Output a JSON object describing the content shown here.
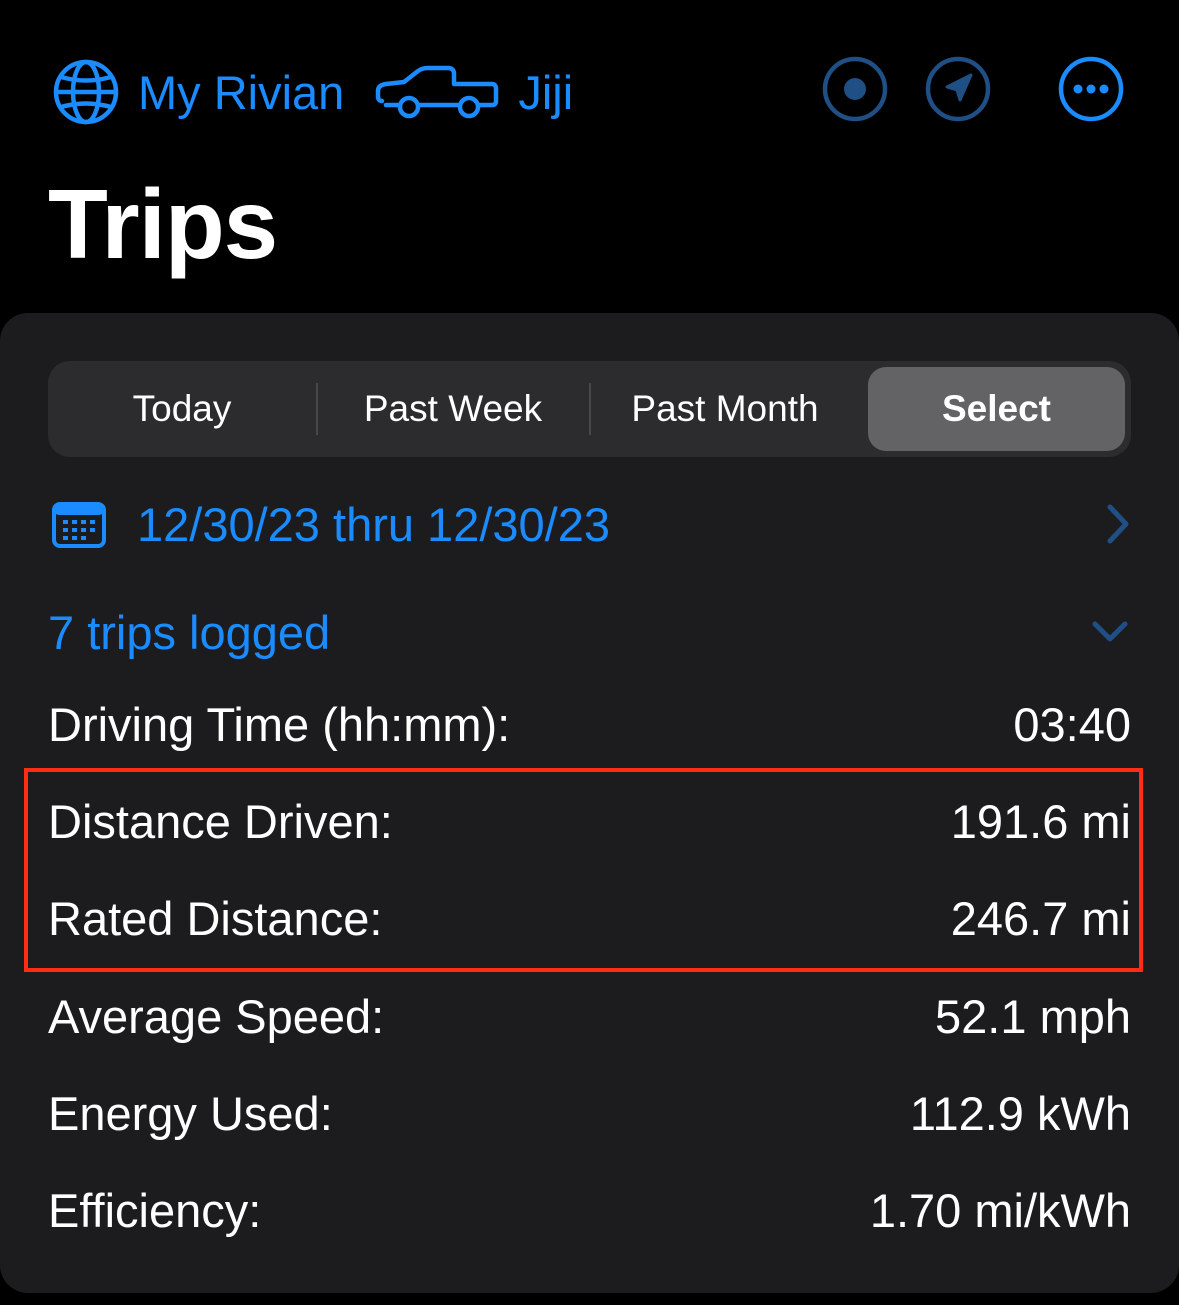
{
  "nav": {
    "home_label": "My Rivian",
    "vehicle_label": "Jiji",
    "icons": {
      "home": "globe-icon",
      "vehicle": "pickup-truck-icon",
      "record": "record-icon",
      "location": "location-arrow-icon",
      "more": "ellipsis-circle-icon"
    }
  },
  "page": {
    "title": "Trips"
  },
  "range_selector": {
    "options": [
      "Today",
      "Past Week",
      "Past Month",
      "Select"
    ],
    "selected": "Select"
  },
  "date_range": {
    "text": "12/30/23 thru 12/30/23",
    "icon": "calendar-icon"
  },
  "trips_logged": {
    "text": "7 trips logged"
  },
  "stats": [
    {
      "label": "Driving Time (hh:mm):",
      "value": "03:40"
    },
    {
      "label": "Distance Driven:",
      "value": "191.6 mi"
    },
    {
      "label": "Rated Distance:",
      "value": "246.7 mi"
    },
    {
      "label": "Average Speed:",
      "value": "52.1 mph"
    },
    {
      "label": "Energy Used:",
      "value": "112.9 kWh"
    },
    {
      "label": "Efficiency:",
      "value": "1.70 mi/kWh"
    }
  ],
  "colors": {
    "accent": "#1a8cff",
    "highlight": "#ff2d16",
    "card": "#1c1c1e",
    "background": "#000000"
  }
}
